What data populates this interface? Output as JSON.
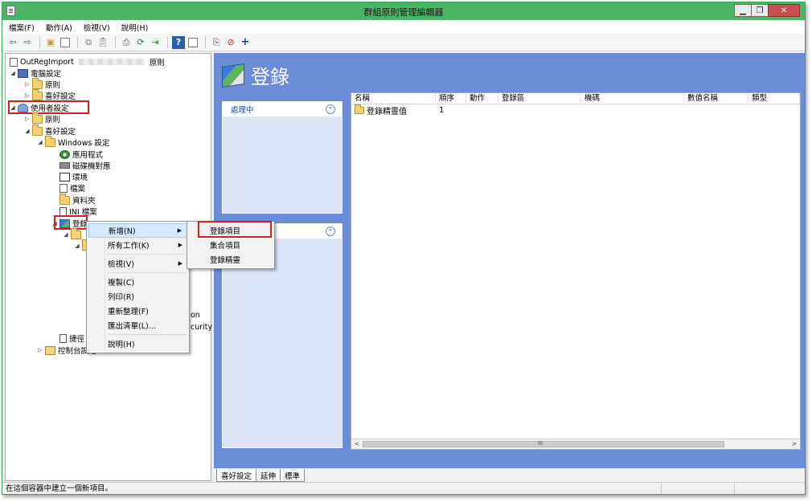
{
  "window": {
    "title": "群組原則管理編輯器",
    "min_label": "▁",
    "max_label": "❐",
    "close_label": "✕"
  },
  "menubar": [
    "檔案(F)",
    "動作(A)",
    "檢視(V)",
    "說明(H)"
  ],
  "toolbar_icons": [
    "back-arrow-icon",
    "forward-arrow-icon",
    "up-folder-icon",
    "show-hide-tree-icon",
    "copy-icon",
    "paste-icon",
    "print-icon",
    "refresh-icon",
    "export-list-icon",
    "help-icon",
    "properties-icon",
    "new-item-icon",
    "stop-icon",
    "add-icon"
  ],
  "tree": {
    "root_label": "OutRegImport",
    "root_suffix": "原則",
    "computer_config": "電腦設定",
    "policies": "原則",
    "preferences": "喜好設定",
    "user_config": "使用者設定",
    "user_policies": "原則",
    "user_preferences": "喜好設定",
    "windows_settings": "Windows 設定",
    "applications": "應用程式",
    "drive_maps": "磁碟機對應",
    "environment": "環境",
    "files": "檔案",
    "folders": "資料夾",
    "ini_files": "INI 檔案",
    "registry": "登錄",
    "partial_on": "on",
    "partial_curity": "curity",
    "shortcuts_partial": "捷徑",
    "control_panel": "控制台設定"
  },
  "header": {
    "title": "登錄"
  },
  "panels": {
    "processing": "處理中"
  },
  "list": {
    "columns": [
      "名稱",
      "順序",
      "動作",
      "登錄區",
      "機碼",
      "數值名稱",
      "類型"
    ],
    "rows": [
      {
        "name": "登錄精靈值",
        "order": "1"
      }
    ],
    "scroll_left": "<",
    "scroll_right": ">",
    "scroll_grip": "III"
  },
  "tabs": [
    "喜好設定",
    "延伸",
    "標準"
  ],
  "status": "在這個容器中建立一個新項目。",
  "context_menu": {
    "items": [
      "新增(N)",
      "所有工作(K)",
      "檢視(V)",
      "複製(C)",
      "列印(R)",
      "重新整理(F)",
      "匯出清單(L)...",
      "說明(H)"
    ]
  },
  "submenu": {
    "items": [
      "登錄項目",
      "集合項目",
      "登錄精靈"
    ]
  },
  "colors": {
    "title_bar": "#4cb465",
    "content_bg": "#6b8cd6",
    "highlight_box": "#d02020"
  }
}
